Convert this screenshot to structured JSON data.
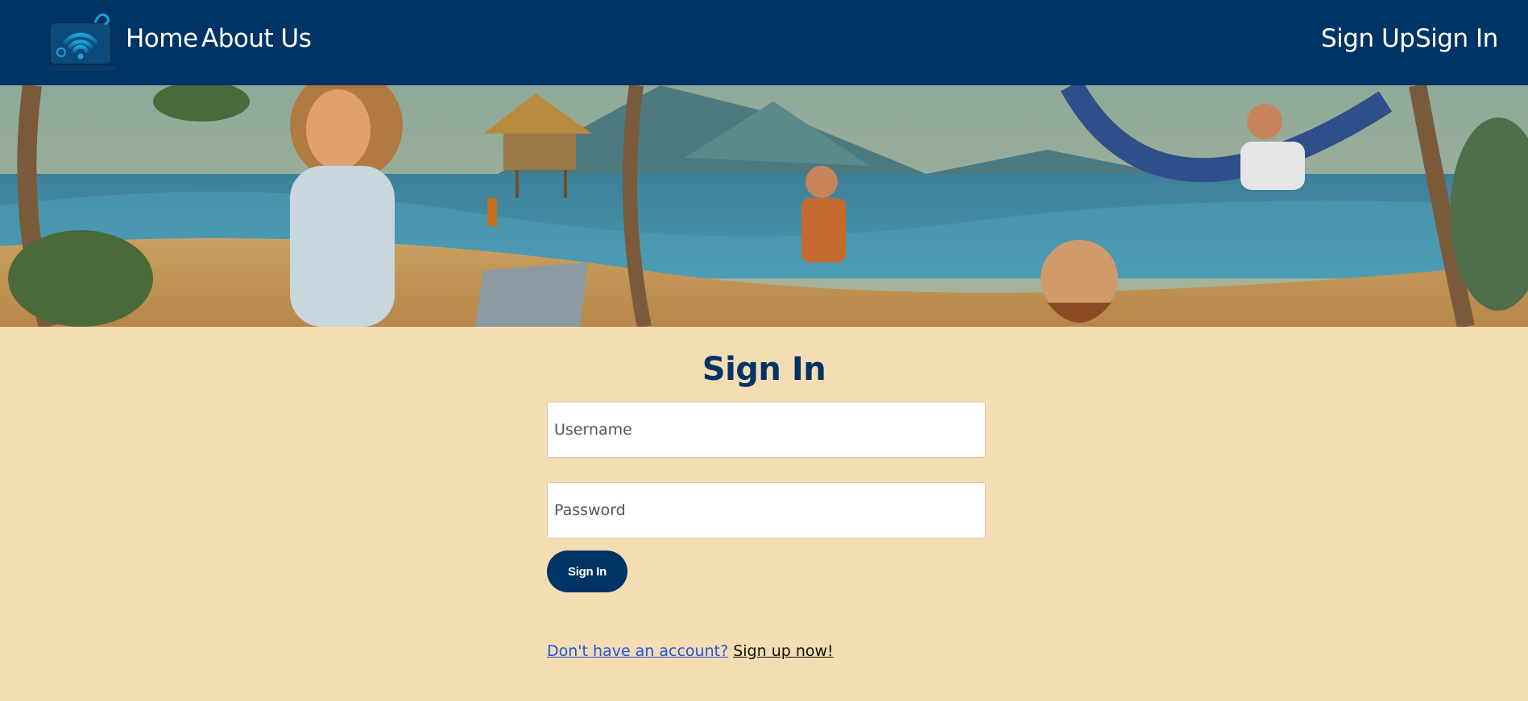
{
  "nav": {
    "home_label": "Home",
    "about_label": "About Us",
    "signup_label": "Sign Up",
    "signin_label": "Sign In"
  },
  "form": {
    "title": "Sign In",
    "username_placeholder": "Username",
    "password_placeholder": "Password",
    "submit_label": "Sign In",
    "prompt_text": "Don't have an account?",
    "signup_link_text": "Sign up now!"
  },
  "colors": {
    "nav_bg": "#003366",
    "page_bg": "#f5ddb3",
    "accent": "#003366",
    "link": "#1a55e0"
  },
  "icons": {
    "logo": "wifi-laptop-camera-logo"
  }
}
